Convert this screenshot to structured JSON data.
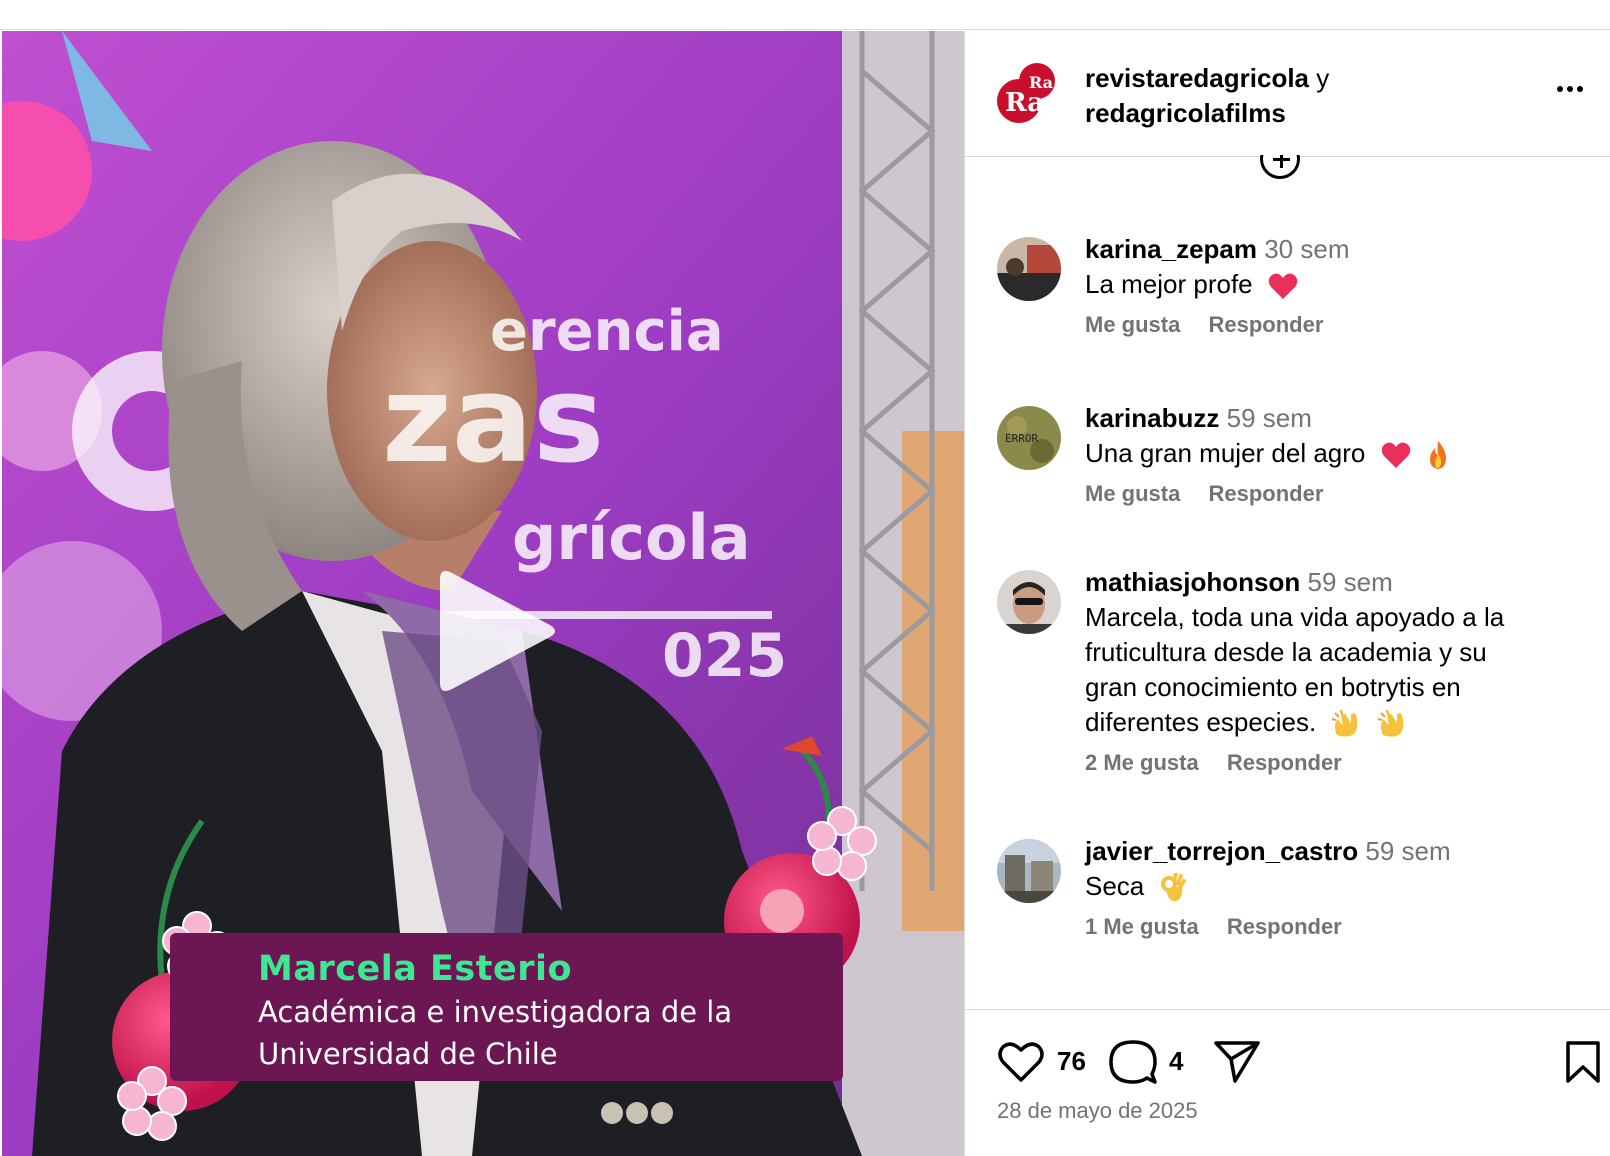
{
  "post": {
    "authors": {
      "first": "revistaredagricola",
      "joiner": "y",
      "second": "redagricolafilms"
    },
    "logo_text": "Ra",
    "likes": "76",
    "comments_count": "4",
    "date": "28 de mayo de 2025"
  },
  "video": {
    "banner_words": [
      "erencia",
      "zas",
      "grícola",
      "025"
    ],
    "caption_name": "Marcela Esterio",
    "caption_line1": "Académica e investigadora de la",
    "caption_line2": "Universidad de Chile"
  },
  "comments": [
    {
      "user": "karina_zepam",
      "time": "30 sem",
      "text": "La mejor profe",
      "emoji": [
        "heart-emoji"
      ],
      "likes_label": "Me gusta",
      "reply_label": "Responder"
    },
    {
      "user": "karinabuzz",
      "time": "59 sem",
      "text": "Una gran mujer del agro",
      "emoji": [
        "heart-emoji",
        "fire-emoji"
      ],
      "likes_label": "Me gusta",
      "reply_label": "Responder",
      "avatar_text": "ERROR"
    },
    {
      "user": "mathiasjohonson",
      "time": "59 sem",
      "text_lines": [
        "Marcela, toda una vida apoyado a la",
        "fruticultura desde la academia y su",
        "gran conocimiento en botrytis en",
        "diferentes especies."
      ],
      "emoji": [
        "clap-emoji",
        "clap-emoji"
      ],
      "likes_label": "2 Me gusta",
      "reply_label": "Responder"
    },
    {
      "user": "javier_torrejon_castro",
      "time": "59 sem",
      "text": "Seca",
      "emoji": [
        "ok-hand-emoji"
      ],
      "likes_label": "1 Me gusta",
      "reply_label": "Responder"
    }
  ],
  "colors": {
    "caption_bg": "#6c1753",
    "caption_name": "#3ee892",
    "muted": "#737373",
    "logo_red": "#c8102e"
  }
}
